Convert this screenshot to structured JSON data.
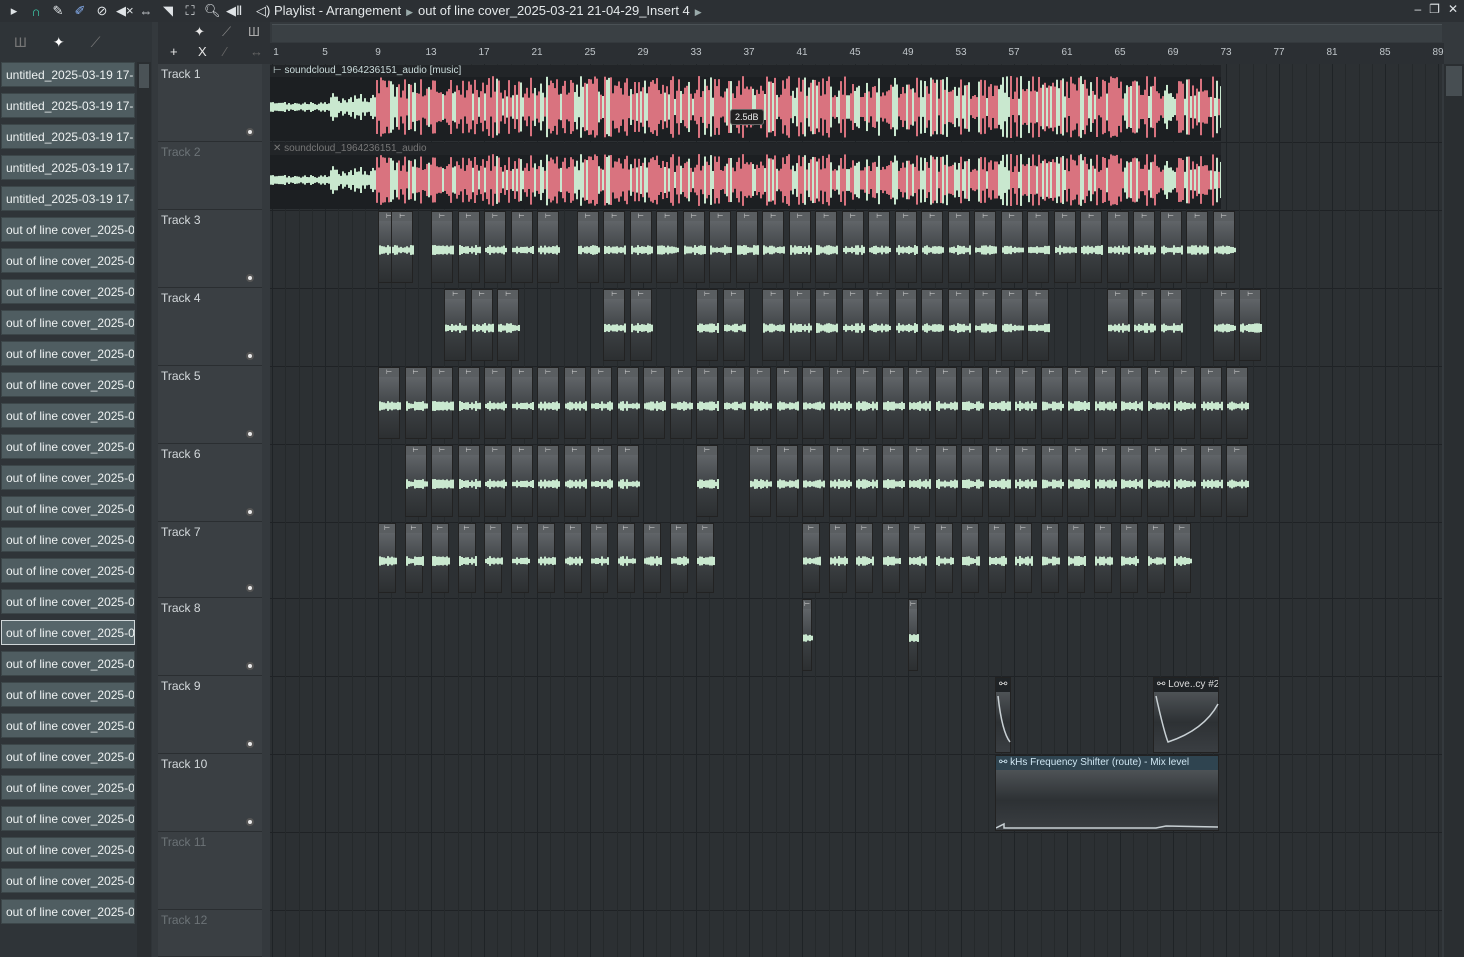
{
  "title": {
    "window": "Playlist - Arrangement",
    "pattern": "out of line cover_2025-03-21 21-04-29_Insert 4"
  },
  "toolbar_icons": [
    "arrow-icon",
    "magnet-icon",
    "pencil-icon",
    "paint-icon",
    "delete-icon",
    "mute-icon",
    "slip-icon",
    "slice-icon",
    "select-icon",
    "zoom-icon",
    "playback-icon"
  ],
  "picker": {
    "items": [
      "untitled_2025-03-19 17-...",
      "untitled_2025-03-19 17-...",
      "untitled_2025-03-19 17-...",
      "untitled_2025-03-19 17-...",
      "untitled_2025-03-19 17-...",
      "out of line cover_2025-0...",
      "out of line cover_2025-0...",
      "out of line cover_2025-0...",
      "out of line cover_2025-0...",
      "out of line cover_2025-0...",
      "out of line cover_2025-0...",
      "out of line cover_2025-0...",
      "out of line cover_2025-0...",
      "out of line cover_2025-0...",
      "out of line cover_2025-0...",
      "out of line cover_2025-0...",
      "out of line cover_2025-0...",
      "out of line cover_2025-0...",
      "out of line cover_2025-0...",
      "out of line cover_2025-0...",
      "out of line cover_2025-0...",
      "out of line cover_2025-0...",
      "out of line cover_2025-0...",
      "out of line cover_2025-0...",
      "out of line cover_2025-0...",
      "out of line cover_2025-0...",
      "out of line cover_2025-0...",
      "out of line cover_2025-0..."
    ],
    "selected": 18
  },
  "ruler": [
    "1",
    "5",
    "9",
    "13",
    "17",
    "21",
    "25",
    "29",
    "33",
    "37",
    "41",
    "45",
    "49",
    "53",
    "57",
    "61",
    "65",
    "69",
    "73",
    "77",
    "81",
    "85",
    "89"
  ],
  "tracks": [
    {
      "name": "Track 1"
    },
    {
      "name": "Track 2",
      "muted": true
    },
    {
      "name": "Track 3"
    },
    {
      "name": "Track 4"
    },
    {
      "name": "Track 5"
    },
    {
      "name": "Track 6"
    },
    {
      "name": "Track 7"
    },
    {
      "name": "Track 8"
    },
    {
      "name": "Track 9"
    },
    {
      "name": "Track 10"
    },
    {
      "name": "Track 11",
      "muted": true
    },
    {
      "name": "Track 12",
      "muted": true
    }
  ],
  "clips": {
    "audio1": "soundcloud_1964236151_audio [music]",
    "audio2": "soundcloud_1964236151_audio",
    "volume_badge": "2.5dB",
    "auto1": "",
    "auto2": "Love..cy #2",
    "auto3": "kHs Frequency Shifter (route) - Mix level"
  },
  "colors": {
    "wave_pink": "#d9737f",
    "wave_mint": "#c9e8cf"
  }
}
